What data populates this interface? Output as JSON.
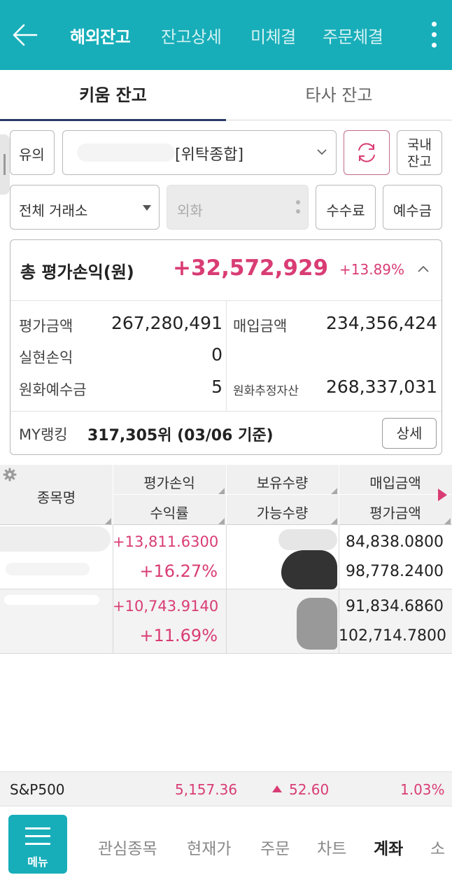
{
  "header": {
    "tabs": [
      "해외잔고",
      "잔고상세",
      "미체결",
      "주문체결"
    ],
    "active_tab": "해외잔고"
  },
  "subtabs": [
    "키움 잔고",
    "타사 잔고"
  ],
  "controls": {
    "notice_label": "유의",
    "account_type": "[위탁종합]",
    "domestic_balance": [
      "국내",
      "잔고"
    ],
    "exchange": "전체 거래소",
    "currency_placeholder": "외화",
    "fee_button": "수수료",
    "deposit_button": "예수금"
  },
  "summary": {
    "title": "총 평가손익(원)",
    "total_pl": "+32,572,929",
    "total_rate": "+13.89%",
    "eval_label": "평가금액",
    "eval_value": "267,280,491",
    "purchase_label": "매입금액",
    "purchase_value": "234,356,424",
    "realized_label": "실현손익",
    "realized_value": "0",
    "krw_deposit_label": "원화예수금",
    "krw_deposit_value": "5",
    "krw_est_asset_label": "원화추정자산",
    "krw_est_asset_value": "268,337,031",
    "rank_label": "MY랭킹",
    "rank_value": "317,305위 (03/06 기준)",
    "detail_button": "상세"
  },
  "table": {
    "headers": {
      "name": "종목명",
      "pl": "평가손익",
      "rate": "수익률",
      "qty": "보유수량",
      "avail_qty": "가능수량",
      "purchase": "매입금액",
      "eval": "평가금액"
    },
    "rows": [
      {
        "pl": "+13,811.6300",
        "rate": "+16.27%",
        "purchase": "84,838.0800",
        "eval": "98,778.2400"
      },
      {
        "pl": "+10,743.9140",
        "rate": "+11.69%",
        "purchase": "91,834.6860",
        "eval": "102,714.7800"
      }
    ]
  },
  "ticker": {
    "name": "S&P500",
    "price": "5,157.36",
    "change": "52.60",
    "change_pct": "1.03%"
  },
  "bottom_nav": {
    "menu_label": "메뉴",
    "items": [
      "관심종목",
      "현재가",
      "주문",
      "차트",
      "계좌",
      "소"
    ],
    "active": "계좌"
  },
  "colors": {
    "primary": "#17aeb9",
    "up": "#d93c74",
    "active_underline": "#2b3a67"
  }
}
